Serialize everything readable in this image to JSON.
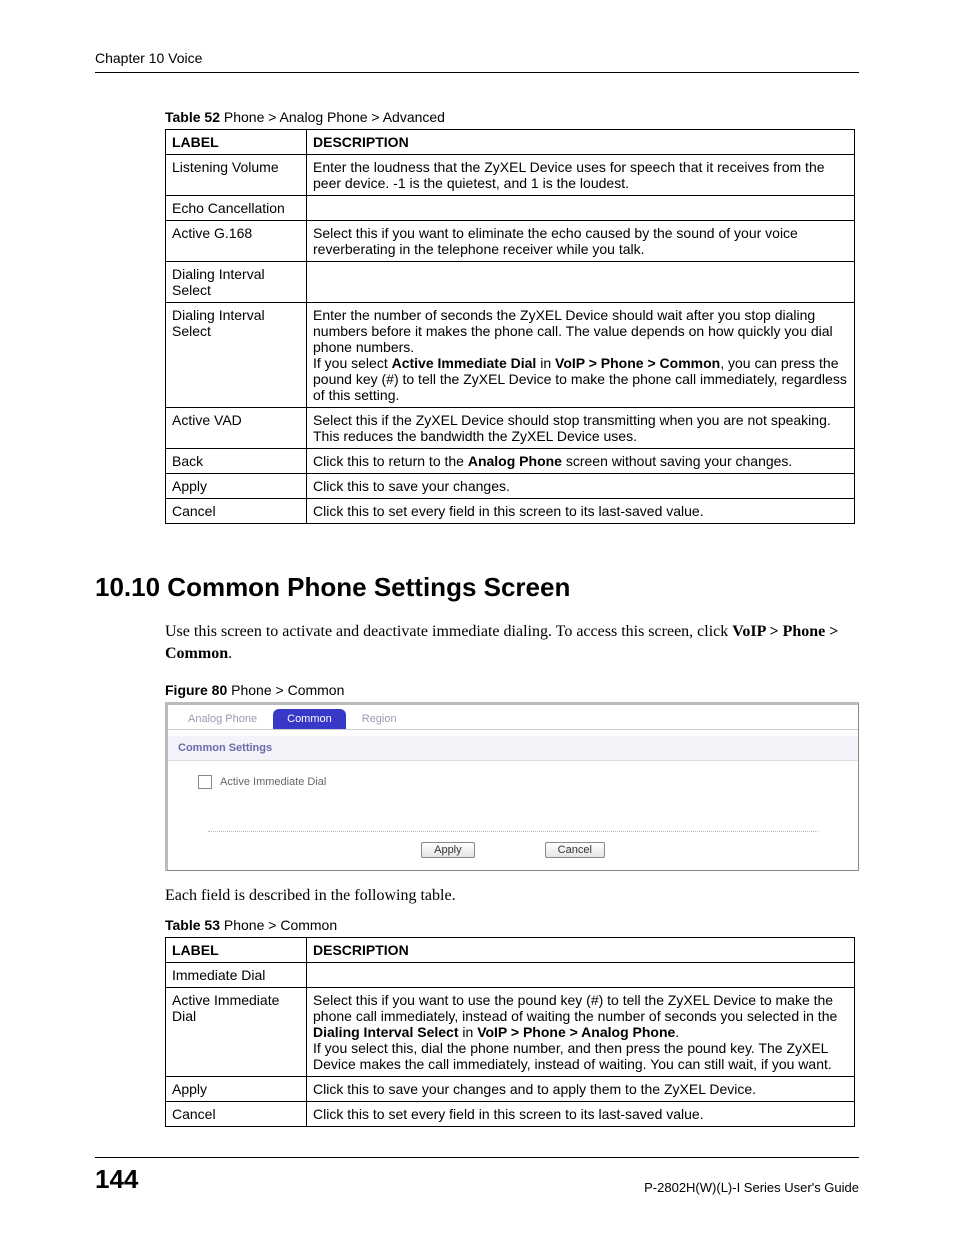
{
  "header": {
    "chapter": "Chapter 10 Voice"
  },
  "table52": {
    "caption_bold": "Table 52",
    "caption_rest": "   Phone > Analog Phone > Advanced",
    "col_label": "LABEL",
    "col_desc": "DESCRIPTION",
    "rows": [
      {
        "label": "Listening Volume",
        "desc": "Enter the loudness that the ZyXEL Device uses for speech that it receives from the peer device. -1 is the quietest, and 1 is the loudest."
      },
      {
        "label": "Echo Cancellation",
        "desc": ""
      },
      {
        "label": "Active G.168",
        "desc": "Select this if you want to eliminate the echo caused by the sound of your voice reverberating in the telephone receiver while you talk."
      },
      {
        "label": "Dialing Interval Select",
        "desc": ""
      },
      {
        "label": "Dialing Interval Select",
        "desc_parts": {
          "p1": "Enter the number of seconds the ZyXEL Device should wait after you stop dialing numbers before it makes the phone call. The value depends on how quickly you dial phone numbers.",
          "p2a": "If you select ",
          "p2b": "Active Immediate Dial",
          "p2c": " in ",
          "p2d": "VoIP > Phone > Common",
          "p2e": ", you can press the pound key (#) to tell the ZyXEL Device to make the phone call immediately, regardless of this setting."
        }
      },
      {
        "label": "Active VAD",
        "desc": "Select this if the ZyXEL Device should stop transmitting when you are not speaking. This reduces the bandwidth the ZyXEL Device uses."
      },
      {
        "label": "Back",
        "desc_parts": {
          "a": "Click this to return to the ",
          "b": "Analog Phone",
          "c": " screen without saving your changes."
        }
      },
      {
        "label": "Apply",
        "desc": "Click this to save your changes."
      },
      {
        "label": "Cancel",
        "desc": "Click this to set every field in this screen to its last-saved value."
      }
    ]
  },
  "section": {
    "heading": "10.10  Common Phone Settings Screen",
    "para_a": "Use this screen to activate and deactivate immediate dialing. To access this screen, click ",
    "para_b": "VoIP > Phone > Common",
    "para_c": "."
  },
  "figure80": {
    "caption_bold": "Figure 80",
    "caption_rest": "   Phone > Common",
    "tabs": {
      "analog": "Analog Phone",
      "common": "Common",
      "region": "Region"
    },
    "panel_title": "Common Settings",
    "checkbox_label": "Active Immediate Dial",
    "apply": "Apply",
    "cancel": "Cancel"
  },
  "after_figure": "Each field is described in the following table.",
  "table53": {
    "caption_bold": "Table 53",
    "caption_rest": "   Phone > Common",
    "col_label": "LABEL",
    "col_desc": "DESCRIPTION",
    "rows": {
      "r1": {
        "label": "Immediate Dial",
        "desc": ""
      },
      "r2": {
        "label": "Active Immediate Dial",
        "p1a": "Select this if you want to use the pound key (#) to tell the ZyXEL Device to make the phone call immediately, instead of waiting the number of seconds you selected in the ",
        "p1b": "Dialing Interval Select",
        "p1c": " in ",
        "p1d": "VoIP > Phone > Analog Phone",
        "p1e": ".",
        "p2": "If you select this, dial the phone number, and then press the pound key. The ZyXEL Device makes the call immediately, instead of waiting. You can still wait, if you want."
      },
      "r3": {
        "label": "Apply",
        "desc": "Click this to save your changes and to apply them to the ZyXEL Device."
      },
      "r4": {
        "label": "Cancel",
        "desc": "Click this to set every field in this screen to its last-saved value."
      }
    }
  },
  "footer": {
    "page": "144",
    "guide": "P-2802H(W)(L)-I Series User's Guide"
  }
}
